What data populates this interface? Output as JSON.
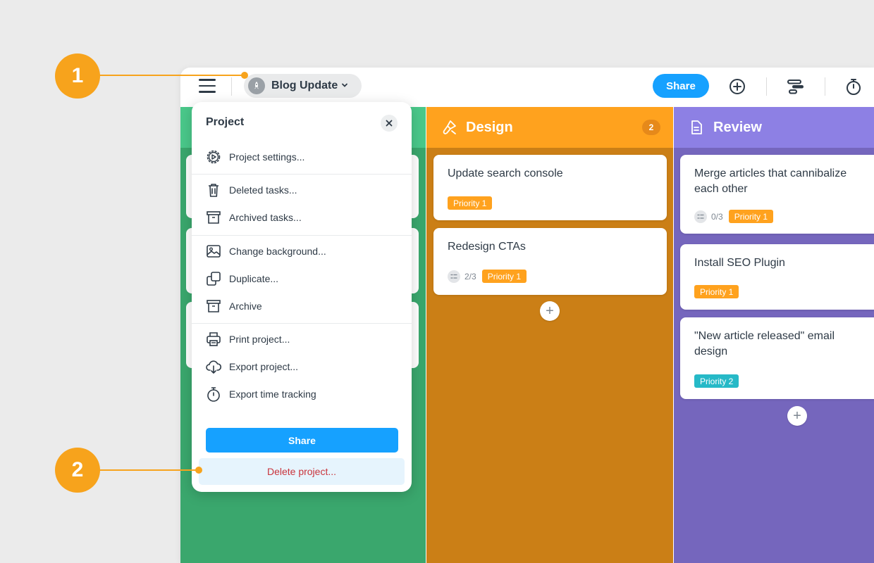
{
  "callouts": {
    "one": "1",
    "two": "2"
  },
  "topbar": {
    "project_name": "Blog Update",
    "share_label": "Share"
  },
  "columns": [
    {
      "title": "Design",
      "count": "2",
      "cards": [
        {
          "title": "Update search console",
          "priority": "Priority 1"
        },
        {
          "title": "Redesign CTAs",
          "checklist": "2/3",
          "priority": "Priority 1"
        }
      ]
    },
    {
      "title": "Review",
      "cards": [
        {
          "title": "Merge articles that cannibalize each other",
          "checklist": "0/3",
          "priority": "Priority 1"
        },
        {
          "title": "Install SEO Plugin",
          "priority": "Priority 1"
        },
        {
          "title": "\"New article released\" email design",
          "priority": "Priority 2"
        }
      ]
    }
  ],
  "dropdown": {
    "title": "Project",
    "items": [
      {
        "label": "Project settings..."
      },
      {
        "label": "Deleted tasks..."
      },
      {
        "label": "Archived tasks..."
      },
      {
        "label": "Change background..."
      },
      {
        "label": "Duplicate..."
      },
      {
        "label": "Archive"
      },
      {
        "label": "Print project..."
      },
      {
        "label": "Export project..."
      },
      {
        "label": "Export time tracking"
      }
    ],
    "share_label": "Share",
    "delete_label": "Delete project..."
  },
  "colors": {
    "accent": "#16a1ff",
    "callout": "#f7a31c",
    "green": "#4ac88a",
    "orange": "#ffa21e",
    "purple": "#8d80e4",
    "danger": "#c9343c"
  },
  "icons": [
    "hamburger-icon",
    "rocket-icon",
    "chevron-down-icon",
    "plus-circle-icon",
    "timeline-icon",
    "stopwatch-icon",
    "paint-brush-icon",
    "document-icon",
    "close-icon",
    "gear-play-icon",
    "trash-icon",
    "archive-box-icon",
    "image-icon",
    "duplicate-icon",
    "printer-icon",
    "cloud-download-icon",
    "checklist-icon",
    "plus-icon"
  ]
}
